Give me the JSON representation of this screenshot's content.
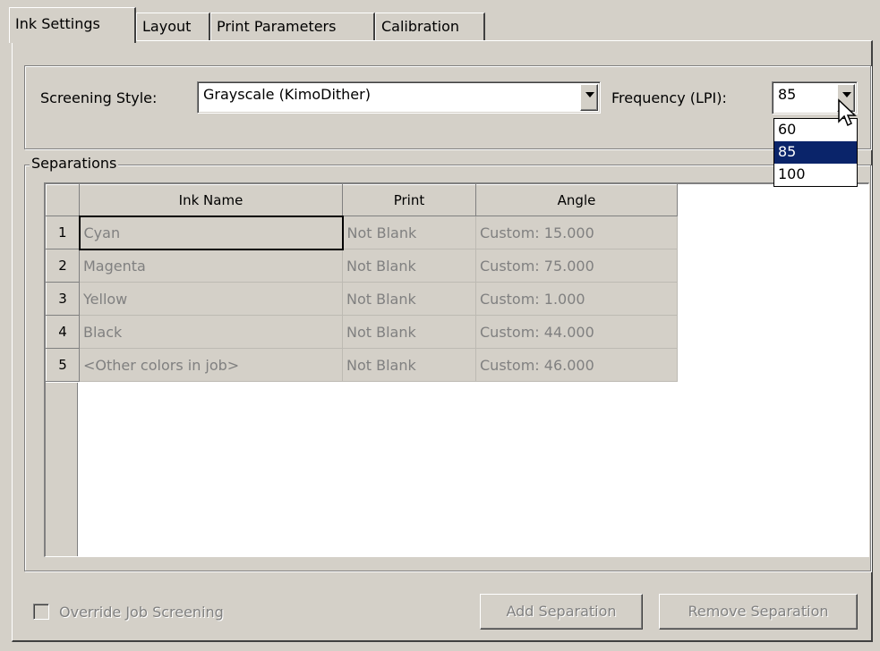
{
  "tabs": [
    {
      "label": "Ink Settings",
      "active": true
    },
    {
      "label": "Layout"
    },
    {
      "label": "Print Parameters"
    },
    {
      "label": "Calibration"
    }
  ],
  "screening": {
    "style_label": "Screening Style:",
    "style_value": "Grayscale (KimoDither)",
    "frequency_label": "Frequency (LPI):",
    "frequency_value": "85",
    "frequency_options": [
      "60",
      "85",
      "100"
    ],
    "frequency_selected": "85"
  },
  "separations": {
    "group_label": "Separations",
    "columns": [
      "Ink Name",
      "Print",
      "Angle"
    ],
    "rows": [
      {
        "num": "1",
        "ink": "Cyan",
        "print": "Not Blank",
        "angle": "Custom: 15.000"
      },
      {
        "num": "2",
        "ink": "Magenta",
        "print": "Not Blank",
        "angle": "Custom: 75.000"
      },
      {
        "num": "3",
        "ink": "Yellow",
        "print": "Not Blank",
        "angle": "Custom: 1.000"
      },
      {
        "num": "4",
        "ink": "Black",
        "print": "Not Blank",
        "angle": "Custom: 44.000"
      },
      {
        "num": "5",
        "ink": "<Other colors in job>",
        "print": "Not Blank",
        "angle": "Custom: 46.000"
      }
    ]
  },
  "footer": {
    "override_label": "Override Job Screening",
    "override_checked": false,
    "add_button": "Add Separation",
    "remove_button": "Remove Separation"
  },
  "icons": {
    "dropdown_arrow": "triangle-down-icon",
    "cursor": "arrow-cursor-icon"
  }
}
